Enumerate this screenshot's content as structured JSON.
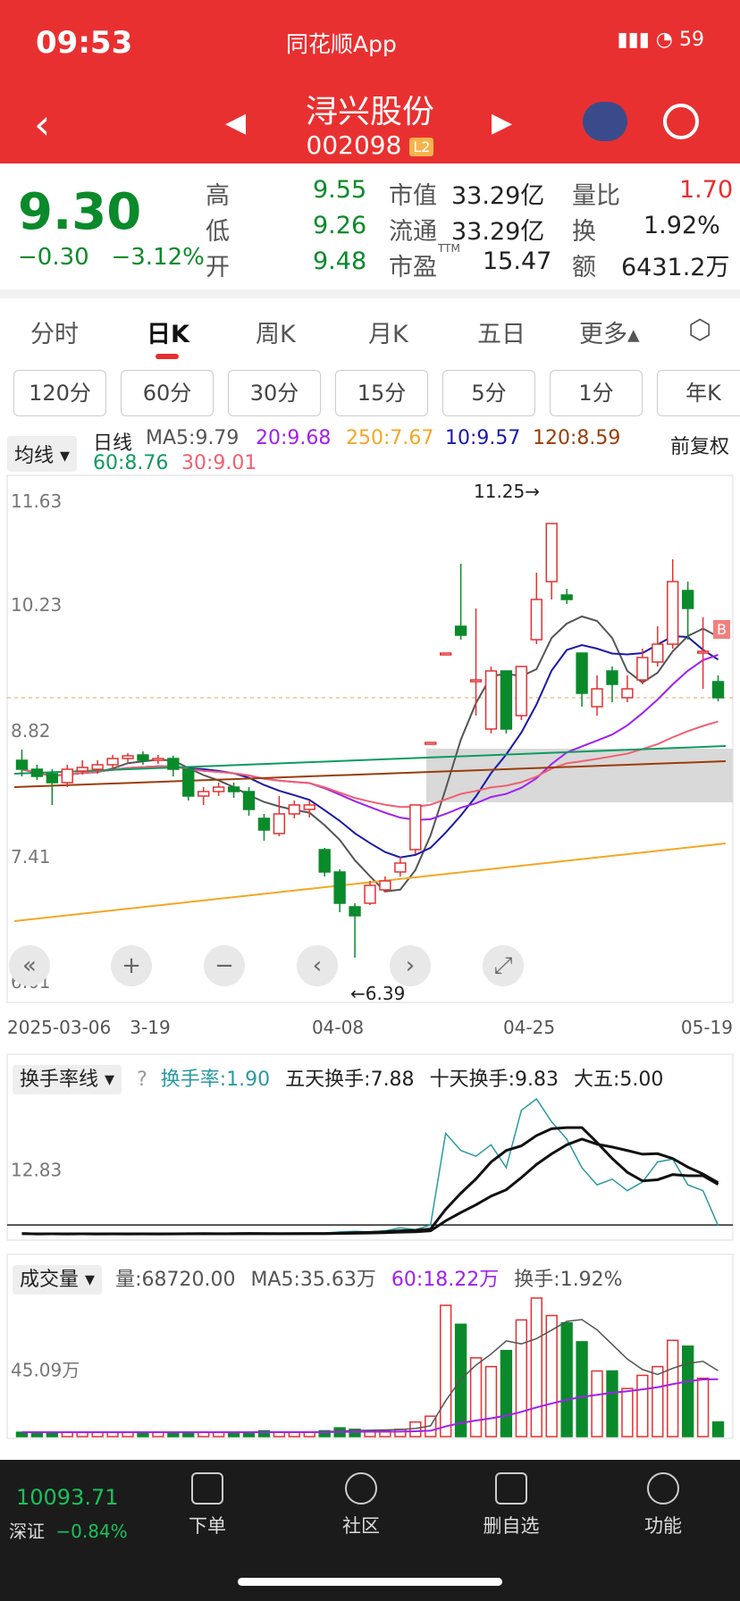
{
  "status": {
    "time": "09:53",
    "app": "同花顺App",
    "battery": "59"
  },
  "header": {
    "title": "浔兴股份",
    "code": "002098",
    "badge": "L2"
  },
  "quote": {
    "price": "9.30",
    "change": "−0.30",
    "change_pct": "−3.12%",
    "rows": [
      {
        "l1": "高",
        "v1": "9.55",
        "l2": "市值",
        "v2": "33.29亿",
        "l3": "量比",
        "v3": "1.70"
      },
      {
        "l1": "低",
        "v1": "9.26",
        "l2": "流通",
        "v2": "33.29亿",
        "l3": "换",
        "v3": "1.92%"
      },
      {
        "l1": "开",
        "v1": "9.48",
        "l2": "市盈",
        "v2": "15.47",
        "l3": "额",
        "v3": "6431.2万"
      }
    ],
    "ttm": "TTM"
  },
  "tabs": [
    "分时",
    "日K",
    "周K",
    "月K",
    "五日",
    "更多▴"
  ],
  "periods": [
    "120分",
    "60分",
    "30分",
    "15分",
    "5分",
    "1分",
    "年K"
  ],
  "ma": {
    "dropdown": "均线",
    "kind": "日线",
    "ma5": "MA5:9.79",
    "ma20": "20:9.68",
    "ma250": "250:7.67",
    "ma10": "10:9.57",
    "ma120": "120:8.59",
    "ma60": "60:8.76",
    "ma30": "30:9.01",
    "adjust": "前复权"
  },
  "kline": {
    "y_ticks": [
      "11.63",
      "10.23",
      "8.82",
      "7.41",
      "6.01"
    ],
    "high_label": "11.25→",
    "low_label": "←6.39",
    "dates": [
      "2025-03-06",
      "3-19",
      "04-08",
      "04-25",
      "05-19"
    ],
    "b_marker": "B"
  },
  "turnover": {
    "dropdown": "换手率线",
    "help": "?",
    "t1": "换手率:1.90",
    "t5": "五天换手:7.88",
    "t10": "十天换手:9.83",
    "big5": "大五:5.00",
    "y_tick": "12.83"
  },
  "volume": {
    "dropdown": "成交量",
    "v": "量:68720.00",
    "ma5": "MA5:35.63万",
    "ma60": "60:18.22万",
    "turn": "换手:1.92%",
    "y_tick": "45.09万"
  },
  "index": {
    "value": "10093.71",
    "name": "深证",
    "pct": "−0.84%"
  },
  "bottom_nav": [
    "下单",
    "社区",
    "删自选",
    "功能"
  ],
  "colors": {
    "up": "#e53030",
    "down": "#0a8a2a",
    "header": "#e93030"
  },
  "chart_data": {
    "type": "candlestick",
    "candles": [
      [
        8.6,
        8.5,
        8.72,
        8.42
      ],
      [
        8.5,
        8.42,
        8.55,
        8.38
      ],
      [
        8.45,
        8.35,
        8.5,
        8.1
      ],
      [
        8.35,
        8.5,
        8.55,
        8.3
      ],
      [
        8.48,
        8.52,
        8.6,
        8.44
      ],
      [
        8.5,
        8.55,
        8.6,
        8.45
      ],
      [
        8.55,
        8.62,
        8.66,
        8.5
      ],
      [
        8.62,
        8.65,
        8.68,
        8.58
      ],
      [
        8.66,
        8.6,
        8.7,
        8.55
      ],
      [
        8.6,
        8.62,
        8.66,
        8.56
      ],
      [
        8.62,
        8.5,
        8.65,
        8.42
      ],
      [
        8.5,
        8.2,
        8.52,
        8.15
      ],
      [
        8.2,
        8.25,
        8.3,
        8.1
      ],
      [
        8.25,
        8.3,
        8.35,
        8.2
      ],
      [
        8.3,
        8.25,
        8.35,
        8.18
      ],
      [
        8.25,
        8.05,
        8.3,
        7.98
      ],
      [
        7.95,
        7.82,
        8.0,
        7.7
      ],
      [
        7.78,
        8.0,
        8.2,
        7.75
      ],
      [
        8.0,
        8.1,
        8.15,
        7.95
      ],
      [
        8.05,
        8.1,
        8.15,
        7.96
      ],
      [
        7.6,
        7.35,
        7.62,
        7.3
      ],
      [
        7.35,
        7.0,
        7.38,
        6.9
      ],
      [
        6.96,
        6.86,
        7.0,
        6.39
      ],
      [
        7.0,
        7.2,
        7.25,
        6.98
      ],
      [
        7.15,
        7.25,
        7.3,
        7.12
      ],
      [
        7.35,
        7.45,
        7.52,
        7.3
      ],
      [
        7.6,
        8.1,
        8.1,
        7.55
      ],
      [
        8.8,
        8.8,
        8.8,
        8.8
      ],
      [
        9.8,
        9.8,
        9.8,
        9.8
      ],
      [
        10.1,
        10.0,
        10.8,
        9.95
      ],
      [
        9.5,
        9.5,
        10.3,
        9.1
      ],
      [
        8.95,
        9.6,
        9.65,
        8.9
      ],
      [
        9.6,
        8.95,
        9.6,
        8.9
      ],
      [
        9.1,
        9.65,
        9.65,
        9.05
      ],
      [
        9.95,
        10.4,
        10.7,
        9.9
      ],
      [
        10.6,
        11.25,
        11.25,
        10.4
      ],
      [
        10.45,
        10.4,
        10.52,
        10.35
      ],
      [
        9.8,
        9.35,
        9.8,
        9.2
      ],
      [
        9.2,
        9.4,
        9.55,
        9.1
      ],
      [
        9.6,
        9.45,
        9.65,
        9.25
      ],
      [
        9.3,
        9.4,
        9.55,
        9.25
      ],
      [
        9.5,
        9.75,
        9.85,
        9.45
      ],
      [
        9.7,
        9.9,
        10.1,
        9.65
      ],
      [
        9.9,
        10.6,
        10.85,
        9.85
      ],
      [
        10.5,
        10.3,
        10.6,
        9.95
      ],
      [
        9.8,
        9.82,
        10.2,
        9.4
      ],
      [
        9.48,
        9.3,
        9.55,
        9.26
      ]
    ],
    "turnover_series": [
      0.5,
      0.4,
      0.5,
      0.4,
      0.5,
      0.4,
      0.5,
      0.4,
      0.5,
      0.4,
      0.5,
      0.6,
      0.5,
      0.4,
      0.5,
      0.6,
      0.5,
      0.4,
      0.5,
      0.5,
      0.6,
      0.8,
      0.9,
      0.8,
      1.0,
      1.5,
      1.2,
      2.0,
      18.0,
      15.0,
      14.0,
      16.0,
      12.0,
      22.0,
      24.0,
      20.0,
      17.0,
      12.0,
      9.0,
      10.0,
      8.0,
      9.5,
      13.0,
      13.5,
      9.0,
      8.0,
      1.9
    ],
    "volume_series": [
      3,
      3,
      3,
      3,
      3,
      3,
      3,
      3,
      3,
      3,
      3,
      3,
      3,
      3,
      3,
      3,
      4,
      3,
      3,
      3,
      4,
      6,
      5,
      4,
      4,
      5,
      10,
      14,
      90,
      77,
      54,
      48,
      59,
      80,
      95,
      83,
      78,
      65,
      45,
      45,
      33,
      42,
      48,
      66,
      62,
      40,
      10
    ]
  }
}
